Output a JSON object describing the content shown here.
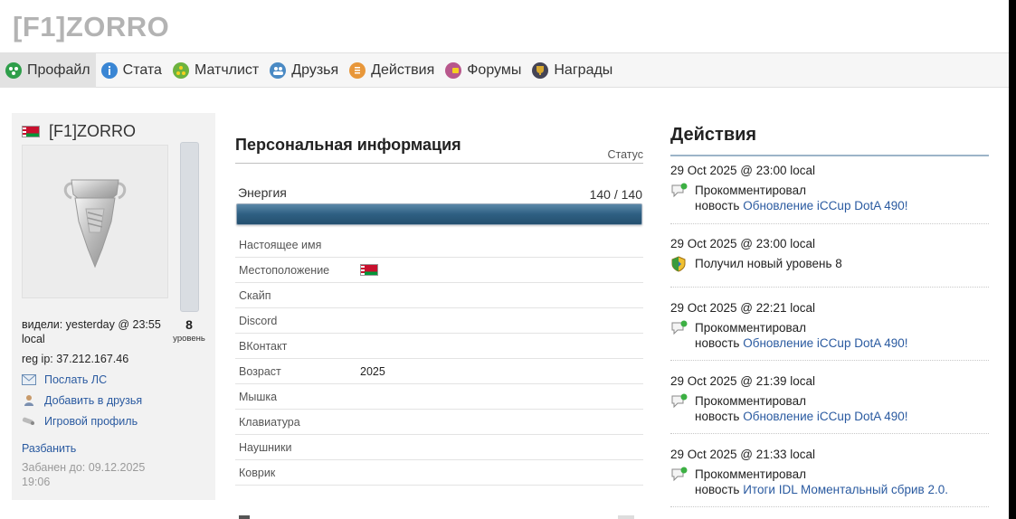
{
  "site_title": "[F1]ZORRO",
  "nav": {
    "items": [
      {
        "label": "Профайл",
        "icon": "profile-icon",
        "color": "#2e9e4a",
        "active": true
      },
      {
        "label": "Стата",
        "icon": "stats-icon",
        "color": "#3a86d4"
      },
      {
        "label": "Матчлист",
        "icon": "matchlist-icon",
        "color": "#6cb33f"
      },
      {
        "label": "Друзья",
        "icon": "friends-icon",
        "color": "#4a8ac4"
      },
      {
        "label": "Действия",
        "icon": "actions-icon",
        "color": "#e8973a"
      },
      {
        "label": "Форумы",
        "icon": "forums-icon",
        "color": "#b8578c"
      },
      {
        "label": "Награды",
        "icon": "awards-icon",
        "color": "#d8a830"
      }
    ]
  },
  "profile": {
    "name": "[F1]ZORRO",
    "seen": "видели: yesterday @ 23:55 local",
    "level": "8",
    "level_label": "уровень",
    "reg_ip": "reg ip: 37.212.167.46",
    "actions": [
      {
        "label": "Послать ЛС",
        "icon": "envelope-icon"
      },
      {
        "label": "Добавить в друзья",
        "icon": "add-friend-icon"
      },
      {
        "label": "Игровой профиль",
        "icon": "game-profile-icon"
      }
    ],
    "ban_link": "Разбанить",
    "ban_info": "Забанен до: 09.12.2025 19:06"
  },
  "personal": {
    "title": "Персональная информация",
    "status_label": "Статус",
    "energy_label": "Энергия",
    "energy_value": "140 / 140",
    "energy_fraction": 1.0,
    "rows": [
      {
        "label": "Настоящее имя",
        "value": ""
      },
      {
        "label": "Местоположение",
        "value": "",
        "flag": true
      },
      {
        "label": "Скайп",
        "value": ""
      },
      {
        "label": "Discord",
        "value": ""
      },
      {
        "label": "ВКонтакт",
        "value": ""
      },
      {
        "label": "Возраст",
        "value": "2025"
      },
      {
        "label": "Мышка",
        "value": ""
      },
      {
        "label": "Клавиатура",
        "value": ""
      },
      {
        "label": "Наушники",
        "value": ""
      },
      {
        "label": "Коврик",
        "value": ""
      }
    ]
  },
  "activity": {
    "title": "Действия",
    "items": [
      {
        "date": "29 Oct 2025 @ 23:00 local",
        "icon": "comment-icon",
        "text1": "Прокомментировал",
        "text2": "новость",
        "link": "Обновление iCCup DotA 490!"
      },
      {
        "date": "29 Oct 2025 @ 23:00 local",
        "icon": "level-shield-icon",
        "text1": "Получил новый уровень  8",
        "text2": "",
        "link": ""
      },
      {
        "date": "29 Oct 2025 @ 22:21 local",
        "icon": "comment-icon",
        "text1": "Прокомментировал",
        "text2": "новость",
        "link": "Обновление iCCup DotA 490!"
      },
      {
        "date": "29 Oct 2025 @ 21:39 local",
        "icon": "comment-icon",
        "text1": "Прокомментировал",
        "text2": "новость",
        "link": "Обновление iCCup DotA 490!"
      },
      {
        "date": "29 Oct 2025 @ 21:33 local",
        "icon": "comment-icon",
        "text1": "Прокомментировал",
        "text2": "новость",
        "link": "Итоги IDL Моментальный сбрив 2.0."
      }
    ]
  }
}
